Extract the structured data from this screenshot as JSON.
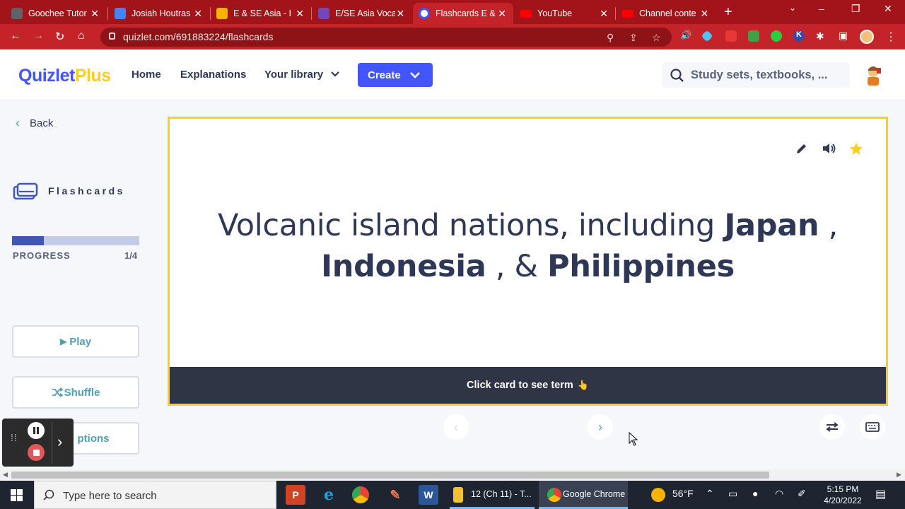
{
  "browser": {
    "tabs": [
      {
        "title": "Goochee Tutor",
        "color": "#5f6368"
      },
      {
        "title": "Josiah Houtras",
        "color": "#4285f4"
      },
      {
        "title": "E & SE Asia - I",
        "color": "#f4b400"
      },
      {
        "title": "E/SE Asia Voca",
        "color": "#7248b9"
      },
      {
        "title": "Flashcards E &",
        "color": "#4255ff"
      },
      {
        "title": "YouTube",
        "color": "#ff0000"
      },
      {
        "title": "Channel conte",
        "color": "#ff0000"
      }
    ],
    "url": "quizlet.com/691883224/flashcards"
  },
  "header": {
    "logo_main": "Quizlet",
    "logo_plus": "Plus",
    "nav": {
      "home": "Home",
      "explanations": "Explanations",
      "library": "Your library"
    },
    "create_label": "Create",
    "search_placeholder": "Study sets, textbooks, ..."
  },
  "sidebar": {
    "back_label": "Back",
    "mode_label": "Flashcards",
    "progress_label": "PROGRESS",
    "progress_count": "1/4",
    "progress_fraction": 0.25,
    "play_label": "Play",
    "shuffle_label": "Shuffle",
    "options_label": "ptions"
  },
  "card": {
    "part1": "Volcanic island nations, including ",
    "term1": "Japan",
    "part2": " , ",
    "term2": "Indonesia",
    "part3": " , & ",
    "term3": "Philippines",
    "footer_label": "Click card to see term",
    "footer_emoji": "👆"
  },
  "taskbar": {
    "search_placeholder": "Type here to search",
    "task_word": "12 (Ch 11) - T...",
    "task_chrome": "Google Chrome",
    "weather": "56°F",
    "time": "5:15 PM",
    "date": "4/20/2022"
  },
  "colors": {
    "brand": "#4255ff",
    "accent_yellow": "#ffcd1f",
    "chrome_red": "#c4232a",
    "teal": "#4ca1b5"
  }
}
